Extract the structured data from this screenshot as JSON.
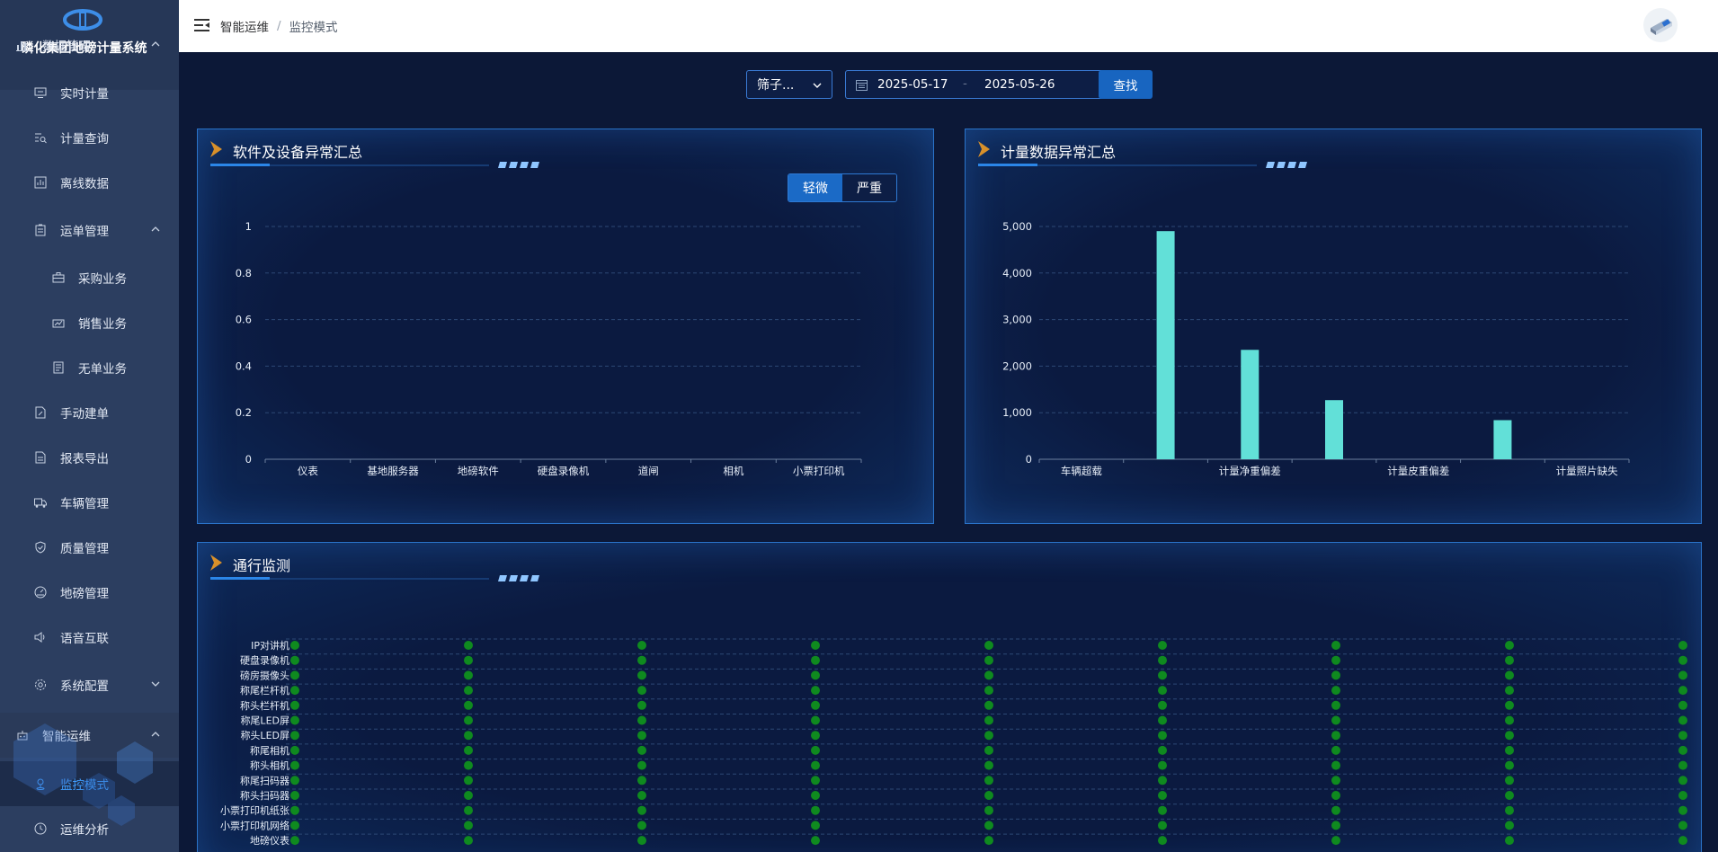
{
  "app": {
    "title": "磷化集团地磅计量系统"
  },
  "sidebar": {
    "items": [
      {
        "label": "数据管理",
        "icon": "bar-chart-icon",
        "expanded": true
      },
      {
        "label": "实时计量",
        "icon": "monitor-icon"
      },
      {
        "label": "计量查询",
        "icon": "search-list-icon"
      },
      {
        "label": "离线数据",
        "icon": "chart-box-icon"
      },
      {
        "label": "运单管理",
        "icon": "clipboard-icon",
        "expanded": true
      },
      {
        "label": "采购业务",
        "icon": "briefcase-icon"
      },
      {
        "label": "销售业务",
        "icon": "trend-icon"
      },
      {
        "label": "无单业务",
        "icon": "document-icon"
      },
      {
        "label": "手动建单",
        "icon": "file-edit-icon"
      },
      {
        "label": "报表导出",
        "icon": "report-icon"
      },
      {
        "label": "车辆管理",
        "icon": "truck-icon"
      },
      {
        "label": "质量管理",
        "icon": "shield-icon"
      },
      {
        "label": "地磅管理",
        "icon": "gauge-icon"
      },
      {
        "label": "语音互联",
        "icon": "speaker-icon"
      },
      {
        "label": "系统配置",
        "icon": "gear-icon",
        "expanded": false
      },
      {
        "label": "智能运维",
        "icon": "robot-icon",
        "expanded": true
      },
      {
        "label": "监控模式",
        "icon": "location-icon",
        "active": true
      },
      {
        "label": "运维分析",
        "icon": "clock-icon"
      }
    ]
  },
  "header": {
    "breadcrumb": [
      "智能运维",
      "监控模式"
    ]
  },
  "filters": {
    "select_value": "筛子...",
    "date_start": "2025-05-17",
    "date_separator": "-",
    "date_end": "2025-05-26",
    "search_label": "查找"
  },
  "colors": {
    "accent": "#1865c0",
    "bar": "#62e0d8",
    "status_ok": "#0f8a1f"
  },
  "panels": {
    "software": {
      "title": "软件及设备异常汇总",
      "tabs": [
        "轻微",
        "严重"
      ],
      "active_tab": 0
    },
    "metering": {
      "title": "计量数据异常汇总"
    },
    "traffic": {
      "title": "通行监测"
    }
  },
  "chart_data": [
    {
      "type": "bar",
      "title": "软件及设备异常汇总",
      "categories": [
        "仪表",
        "基地服务器",
        "地磅软件",
        "硬盘录像机",
        "道闸",
        "相机",
        "小票打印机"
      ],
      "values": [
        0,
        0,
        0,
        0,
        0,
        0,
        0
      ],
      "ylim": [
        0,
        1
      ],
      "yticks": [
        "0",
        "0.2",
        "0.4",
        "0.6",
        "0.8",
        "1"
      ],
      "grid": true
    },
    {
      "type": "bar",
      "title": "计量数据异常汇总",
      "categories": [
        "车辆超载",
        "",
        "计量净重偏差",
        "",
        "计量皮重偏差",
        "",
        "计量照片缺失"
      ],
      "values": [
        0,
        4900,
        2350,
        1270,
        0,
        840,
        0
      ],
      "ylim": [
        0,
        5000
      ],
      "yticks": [
        "0",
        "1,000",
        "2,000",
        "3,000",
        "4,000",
        "5,000"
      ],
      "grid": true
    },
    {
      "type": "scatter",
      "title": "通行监测",
      "categories": [
        "IP对讲机",
        "硬盘录像机",
        "磅房摄像头",
        "称尾栏杆机",
        "称头栏杆机",
        "称尾LED屏",
        "称头LED屏",
        "称尾相机",
        "称头相机",
        "称尾扫码器",
        "称头扫码器",
        "小票打印机纸张",
        "小票打印机网络",
        "地磅仪表"
      ],
      "columns": 9,
      "status": "ok",
      "grid": true
    }
  ]
}
